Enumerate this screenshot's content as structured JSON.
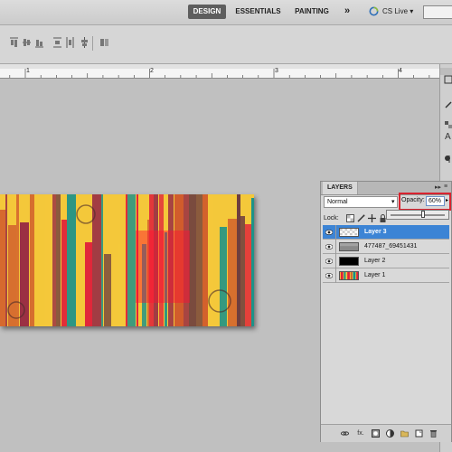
{
  "workspace": {
    "buttons": [
      "DESIGN",
      "ESSENTIALS",
      "PAINTING"
    ],
    "active": "DESIGN",
    "more_label": "»",
    "cs_live_label": "CS Live ▾"
  },
  "ruler": {
    "numbers": [
      "1",
      "2",
      "3",
      "4"
    ]
  },
  "layers_panel": {
    "tab_label": "LAYERS",
    "blend_mode": "Normal",
    "opacity_label": "Opacity:",
    "opacity_value": "60%",
    "opacity_slider_fraction": 0.6,
    "lock_label": "Lock:",
    "layers": [
      {
        "name": "Layer 3",
        "selected": true,
        "thumbnail": "transparent-checker"
      },
      {
        "name": "477487_69451431",
        "selected": false,
        "thumbnail": "gray"
      },
      {
        "name": "Layer 2",
        "selected": false,
        "thumbnail": "black"
      },
      {
        "name": "Layer 1",
        "selected": false,
        "thumbnail": "striped-artwork"
      }
    ],
    "footer_icons": [
      "link-icon",
      "fx-icon",
      "mask-icon",
      "adjustment-icon",
      "group-icon",
      "new-layer-icon",
      "trash-icon"
    ],
    "footer_fx_label": "fx."
  },
  "colors": {
    "selection": "#3c84d5",
    "highlight_frame": "#d8232f",
    "artwork": [
      "#e0203a",
      "#0f8f8e",
      "#f4c83a",
      "#d05a2c",
      "#6b3b3f",
      "#9a2e44"
    ]
  },
  "icons": {
    "cs_live": "cs-live-swirl-icon",
    "options_bar": [
      "align-top-icon",
      "align-middle-icon",
      "align-bottom-icon",
      "distribute-icon",
      "auto-align-icon"
    ],
    "dock": [
      "history-icon",
      "character-icon",
      "paragraph-icon",
      "brush-icon"
    ]
  }
}
